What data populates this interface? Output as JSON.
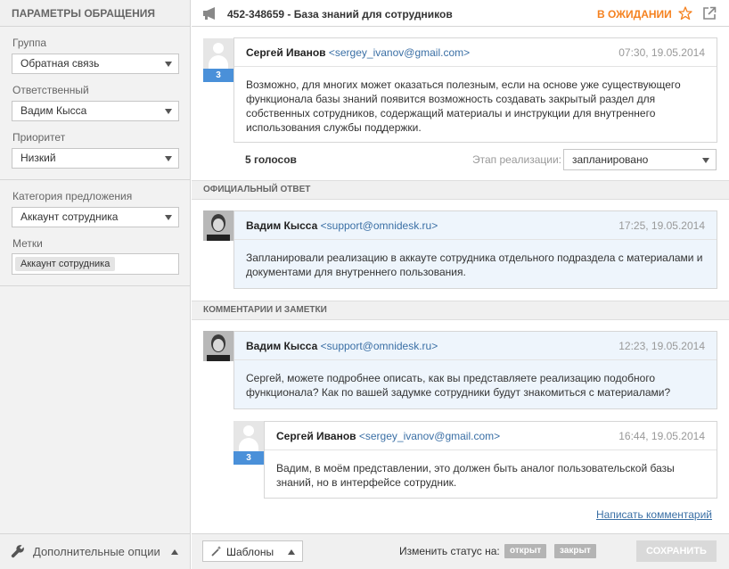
{
  "sidebar": {
    "header": "ПАРАМЕТРЫ ОБРАЩЕНИЯ",
    "group_label": "Группа",
    "group_value": "Обратная связь",
    "assignee_label": "Ответственный",
    "assignee_value": "Вадим Кысса",
    "priority_label": "Приоритет",
    "priority_value": "Низкий",
    "category_label": "Категория предложения",
    "category_value": "Аккаунт сотрудника",
    "tags_label": "Метки",
    "tags": [
      "Аккаунт сотрудника"
    ],
    "footer_label": "Дополнительные опции"
  },
  "topbar": {
    "title": "452-348659 - База знаний для сотрудников",
    "status": "В ОЖИДАНИИ",
    "status_color": "#f58220"
  },
  "original": {
    "name": "Сергей Иванов",
    "email": "<sergey_ivanov@gmail.com>",
    "time": "07:30, 19.05.2014",
    "vote_count": "3",
    "text": "Возможно, для многих может оказаться полезным, если на основе уже существующего функционала базы знаний появится возможность создавать закрытый раздел для собственных сотрудников, содержащий материалы и инструкции для внутреннего использования службы поддержки.",
    "votes_label": "5 голосов",
    "stage_label": "Этап реализации:",
    "stage_value": "запланировано"
  },
  "official": {
    "section": "ОФИЦИАЛЬНЫЙ ОТВЕТ",
    "name": "Вадим Кысса",
    "email": "<support@omnidesk.ru>",
    "time": "17:25, 19.05.2014",
    "text": "Запланировали реализацию в аккауте сотрудника отдельного подраздела с материалами и документами для внутреннего пользования."
  },
  "comments": {
    "section": "КОММЕНТАРИИ И ЗАМЕТКИ",
    "items": [
      {
        "name": "Вадим Кысса",
        "email": "<support@omnidesk.ru>",
        "time": "12:23, 19.05.2014",
        "text": "Сергей, можете подробнее описать, как вы представляете реализацию подобного функционала? Как по вашей задумке сотрудники будут знакомиться с материалами?"
      },
      {
        "name": "Сергей Иванов",
        "email": "<sergey_ivanov@gmail.com>",
        "time": "16:44, 19.05.2014",
        "vote_count": "3",
        "text": "Вадим, в моём представлении, это должен быть аналог пользовательской базы знаний, но в интерфейсе сотрудник."
      }
    ],
    "write_link": "Написать комментарий"
  },
  "bottombar": {
    "templates_label": "Шаблоны",
    "change_status_label": "Изменить статус на:",
    "status_open": "открыт",
    "status_closed": "закрыт",
    "save_label": "СОХРАНИТЬ"
  },
  "colors": {
    "accent_blue": "#4a90d9",
    "link": "#3a6fa5",
    "official_bg": "#eef5fc"
  }
}
